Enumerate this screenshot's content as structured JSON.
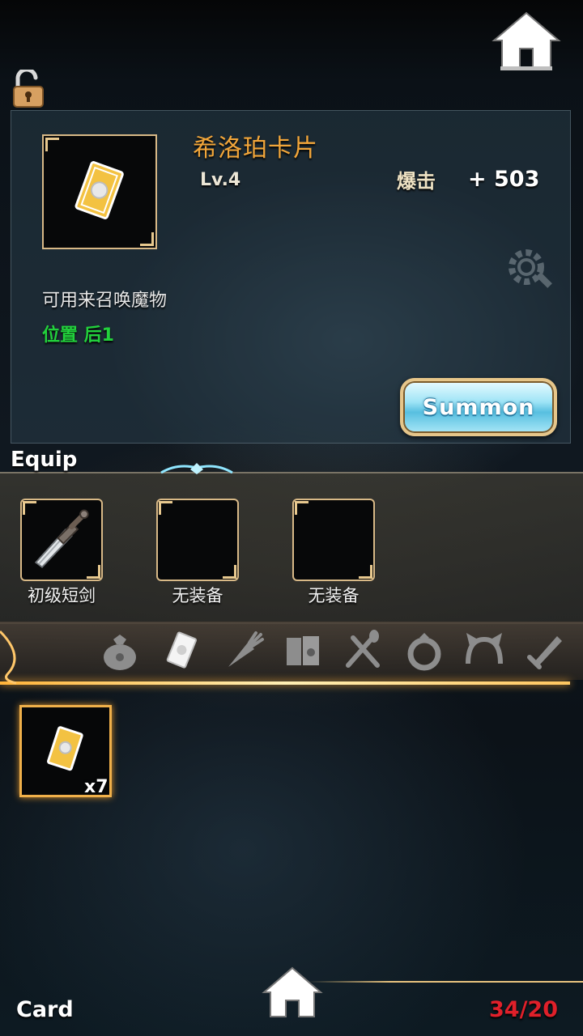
{
  "item": {
    "name": "希洛珀卡片",
    "level": "Lv.4",
    "stat_name": "爆击",
    "stat_value": "+ 503",
    "description": "可用来召唤魔物",
    "position": "位置 后1"
  },
  "actions": {
    "summon_label": "Summon"
  },
  "equip": {
    "title": "Equip",
    "slots": [
      {
        "label": "初级短剑",
        "icon": "dagger-icon"
      },
      {
        "label": "无装备",
        "icon": ""
      },
      {
        "label": "无装备",
        "icon": ""
      }
    ]
  },
  "tabs": [
    {
      "icon": "bag-icon",
      "selected": false
    },
    {
      "icon": "card-icon",
      "selected": true
    },
    {
      "icon": "carrot-icon",
      "selected": false
    },
    {
      "icon": "book-icon",
      "selected": false
    },
    {
      "icon": "fork-spoon-icon",
      "selected": false
    },
    {
      "icon": "ring-icon",
      "selected": false
    },
    {
      "icon": "headband-icon",
      "selected": false
    },
    {
      "icon": "sword-icon",
      "selected": false
    }
  ],
  "inventory": [
    {
      "icon": "card-icon",
      "count": "x7"
    }
  ],
  "footer": {
    "section_label": "Card",
    "capacity": "34/20"
  },
  "colors": {
    "item_name": "#f2a63a",
    "position_text": "#22d13c",
    "capacity": "#e0202a",
    "frame_gold": "#d8b987"
  }
}
